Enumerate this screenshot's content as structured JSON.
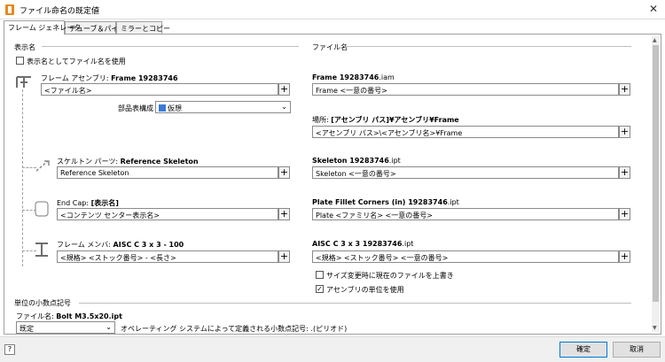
{
  "window": {
    "title": "ファイル命名の既定値"
  },
  "tabs": [
    {
      "label": "フレーム ジェネレータ"
    },
    {
      "label": "チューブ＆パイプ"
    },
    {
      "label": "ミラーとコピー"
    }
  ],
  "display_name": {
    "section": "表示名",
    "use_filename_checkbox": "表示名としてファイル名を使用",
    "frame_assembly_label": "フレーム アセンブリ: ",
    "frame_assembly_value": "Frame 19283746",
    "frame_assembly_field": "<ファイル名>",
    "bom_label": "部品表構成",
    "bom_value": "仮想",
    "skeleton_label": "スケルトン パーツ: ",
    "skeleton_value": "Reference Skeleton",
    "skeleton_field": "Reference Skeleton",
    "endcap_label": "End Cap: ",
    "endcap_value": "[表示名]",
    "endcap_field": "<コンテンツ センター表示名>",
    "member_label": "フレーム メンバ: ",
    "member_value": "AISC C 3 x 3 - 100",
    "member_field": "<規格> <ストック番号> - <長さ>"
  },
  "file_name": {
    "section": "ファイル名",
    "frame_preview_name": "Frame 19283746",
    "frame_preview_ext": ".iam",
    "frame_field": "Frame <一意の番号>",
    "location_label": "場所: ",
    "location_value": "[アセンブリ パス]¥アセンブリ¥Frame",
    "location_field": "<アセンブリ パス>\\<アセンブリ名>¥Frame",
    "skeleton_preview_name": "Skeleton 19283746",
    "skeleton_preview_ext": ".ipt",
    "skeleton_field": "Skeleton <一意の番号>",
    "endcap_preview_name": "Plate Fillet Corners (in) 19283746",
    "endcap_preview_ext": ".ipt",
    "endcap_field": "Plate <ファミリ名> <一意の番号>",
    "member_preview_name": "AISC C 3 x 3 19283746",
    "member_preview_ext": ".ipt",
    "member_field": "<規格> <ストック番号> <一意の番号>",
    "overwrite_checkbox": "サイズ変更時に現在のファイルを上書き",
    "assembly_units_checkbox": "アセンブリの単位を使用",
    "assembly_units_checked": "✓"
  },
  "decimal": {
    "section": "単位の小数点記号",
    "file_label": "ファイル名: ",
    "file_value": "Bolt M3.5x20.ipt",
    "select_value": "既定",
    "note": "オペレーティング システムによって定義される小数点記号: .(ピリオド)"
  },
  "footer": {
    "ok": "確定",
    "cancel": "取消",
    "help": "?"
  },
  "plus_glyph": "+"
}
